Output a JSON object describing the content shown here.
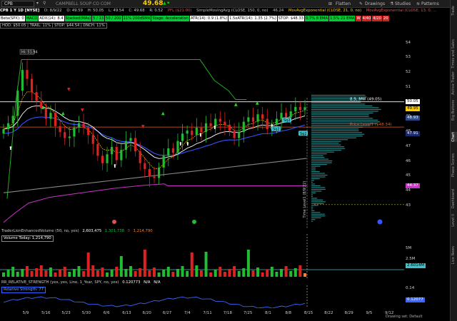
{
  "toolbar": {
    "symbol": "CPB",
    "company": "CAMPBELL SOUP CO COM",
    "last_price": "49.68",
    "flatten_label": "Flatten",
    "drawings_label": "Drawings",
    "studies_label": "Studies",
    "patterns_label": "Patterns"
  },
  "info_row": {
    "period": "CPB 1 Y 1D [NYSE]",
    "date": "D: 8/9/22",
    "open": "O: 49.59",
    "high": "H: 50.05",
    "low": "L: 49.54",
    "close": "C: 49.68",
    "range": "R: 0.52",
    "pfl": "PFL ($21.00)",
    "sma": "SimpleMovingAvg (CLOSE, 150, 0, no)",
    "sma_val": "46.24",
    "ema1": "MovAvgExponential (CLOSE, 21, 0, no)",
    "ema2": "MovAvgExponential (CLOSE, 13, 0, ..."
  },
  "study_labels": [
    {
      "text": "Beta(SPX): 0",
      "color": "#ffffff"
    },
    {
      "text": "MACD",
      "color": "#00cc33"
    },
    {
      "text": "ADX(14): 8.4",
      "color": "#ffffff"
    },
    {
      "text": "Stacked(MAs)",
      "color": "#00cc33"
    },
    {
      "text": "5 / 13",
      "color": "#00cc33"
    },
    {
      "text": "50 / 200",
      "color": "#00cc33"
    },
    {
      "text": "11% 200dSMA",
      "color": "#00cc33"
    },
    {
      "text": "Stage: Acceleration",
      "color": "#00cc33"
    },
    {
      "text": "ATR(14): 0.9 (1.8%)",
      "color": "#ffffff"
    },
    {
      "text": "1.5xATR(14): 1.35 (2.7%)",
      "color": "#ffffff"
    },
    {
      "text": "STOP: $48.33",
      "color": "#ffffff"
    },
    {
      "text": "0.7% 8 EMA",
      "color": "#00cc33"
    },
    {
      "text": "1.5% 21 EMA",
      "color": "#00cc33"
    },
    {
      "text": "W",
      "color": "#cc2222"
    },
    {
      "text": "4/40",
      "color": "#cc2222"
    },
    {
      "text": "4/20",
      "color": "#cc2222"
    },
    {
      "text": "20",
      "color": "#cc2222"
    }
  ],
  "hod_row": "HOD: $50.05  |  TRAIL: 11%  |  STOP: $44.54  |  DNCH: 11%",
  "chart_data": {
    "type": "candlestick",
    "x_ticks": [
      "5/9",
      "5/16",
      "5/23",
      "5/30",
      "6/6",
      "6/13",
      "6/20",
      "6/27",
      "7/4",
      "7/11",
      "7/18",
      "7/25",
      "8/1",
      "8/8",
      "8/15",
      "8/22",
      "8/29",
      "9/5",
      "9/12"
    ],
    "y_ticks": [
      43,
      44,
      45,
      46,
      47,
      48,
      49,
      50,
      51,
      52,
      53,
      54
    ],
    "ylim": [
      41.5,
      55
    ],
    "closes": [
      48.2,
      48.6,
      49.1,
      50.8,
      52.2,
      51.6,
      50.7,
      50.1,
      49.6,
      48.9,
      49.3,
      48.4,
      48.0,
      47.6,
      47.7,
      48.3,
      48.6,
      48.3,
      47.8,
      47.2,
      46.4,
      45.9,
      46.5,
      47.0,
      46.1,
      46.8,
      47.4,
      47.6,
      46.7,
      45.9,
      45.5,
      45.0,
      44.9,
      45.6,
      46.4,
      46.9,
      46.6,
      47.4,
      47.9,
      48.1,
      47.8,
      48.3,
      48.0,
      48.6,
      48.4,
      48.9,
      48.7,
      48.5,
      48.1,
      47.6,
      48.0,
      48.7,
      49.0,
      48.7,
      49.2,
      48.9,
      48.2,
      48.5,
      48.9,
      49.3,
      49.0,
      49.4,
      49.7,
      49.5,
      49.68
    ],
    "price_annotations": [
      {
        "label": "8.9, MW (49.05)",
        "price": 50.05,
        "color": "#ffffff"
      },
      {
        "label": "Price Level1 ($48.34)",
        "price": 48.34,
        "color": "#e06030"
      }
    ],
    "axis_badges": [
      {
        "text": "50.05",
        "price": 50.05,
        "bg": "#ffffff",
        "fg": "#000"
      },
      {
        "text": "49.95",
        "price": 49.6,
        "bg": "#ffcc00",
        "fg": "#000"
      },
      {
        "text": "48.93",
        "price": 48.93,
        "bg": "#2a4a8a",
        "fg": "#fff"
      },
      {
        "text": "47.91",
        "price": 47.91,
        "bg": "#1a2a6a",
        "fg": "#fff"
      },
      {
        "text": "44.37",
        "price": 44.37,
        "bg": "#cc33cc",
        "fg": "#fff"
      }
    ],
    "high_label": "Hi: 51.94",
    "time_level_label": "Time Level1 (8/9/22)",
    "bubbles": [
      "Sq2",
      "Sq2",
      "Sq2"
    ]
  },
  "volume_panel": {
    "header_study": "TraderLionEnhancedVolume (50, no, yes)",
    "header_v1": "2,603,475",
    "header_v2": "1,301,738",
    "header_v3": "0",
    "header_v4": "1,214,790",
    "today_label": "Volume Today: 1,214,790",
    "axis_badge": "2.6014M",
    "axis_top": "5M",
    "axis_mid": "2.5M"
  },
  "rs_panel": {
    "header": "RR_RELATIVE_STRENGTH (yes, yes, Line, 1_Year, SPY, no, yes)",
    "header_val": "0.120773",
    "na1": "N/A",
    "na2": "N/A",
    "rs_label": "Relative Strength: 77",
    "axis_top": "0.14",
    "axis_badge": "0.12077"
  },
  "sidebar_tabs": [
    "Trade",
    "Times and Sales",
    "Active Trader",
    "Big Buttons",
    "Chart",
    "Phase Scores",
    "Dashboard",
    "Level II",
    "Live News"
  ],
  "status": "Drawing set: Default"
}
